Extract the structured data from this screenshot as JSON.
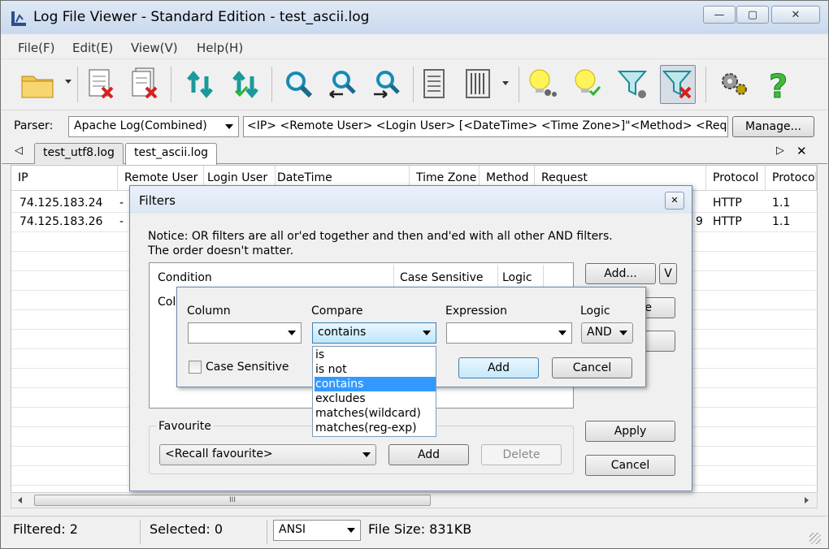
{
  "window": {
    "title": "Log File Viewer - Standard Edition - test_ascii.log",
    "controls": {
      "minimize": "—",
      "maximize": "▢",
      "close": "✕"
    }
  },
  "menu": [
    "File(F)",
    "Edit(E)",
    "View(V)",
    "Help(H)"
  ],
  "toolbar": {
    "icons": [
      "open-folder-icon",
      "close-file-icon",
      "close-all-icon",
      "refresh-icon",
      "refresh-check-icon",
      "search-icon",
      "search-prev-icon",
      "search-next-icon",
      "document-icon",
      "columns-icon",
      "bulb-settings-icon",
      "bulb-check-icon",
      "filter-settings-icon",
      "filter-remove-icon",
      "gear-icon",
      "help-icon"
    ]
  },
  "parser": {
    "label": "Parser:",
    "selected": "Apache Log(Combined)",
    "format": "<IP> <Remote User> <Login User> [<DateTime> <Time Zone>]\"<Method> <Reques",
    "manage_label": "Manage..."
  },
  "tabs": {
    "nav_left": "◁",
    "nav_right": "▷",
    "close": "✕",
    "items": [
      "test_utf8.log",
      "test_ascii.log"
    ],
    "active": 1
  },
  "table": {
    "columns": [
      "IP",
      "Remote User",
      "Login User",
      "DateTime",
      "Time Zone",
      "Method",
      "Request",
      "Protocol",
      "Protocol"
    ],
    "rows": [
      {
        "ip": "74.125.183.24",
        "remote": "-",
        "protocol": "HTTP",
        "version": "1.1",
        "extra": ""
      },
      {
        "ip": "74.125.183.26",
        "remote": "-",
        "protocol": "HTTP",
        "version": "1.1",
        "extra": "9"
      }
    ]
  },
  "scroll": {
    "thumb": "III"
  },
  "status": {
    "filtered": "Filtered: 2",
    "selected": "Selected: 0",
    "encoding": "ANSI",
    "filesize": "File Size: 831KB"
  },
  "filters_dialog": {
    "title": "Filters",
    "close": "✕",
    "notice_line1": "Notice: OR filters are all or'ed together and then and'ed with all other AND filters.",
    "notice_line2": "The order doesn't matter.",
    "list_headers": [
      "Condition",
      "Case Sensitive",
      "Logic"
    ],
    "first_cell": "Colu",
    "add_label": "Add...",
    "v_label": "V",
    "hidden_btn_text": "e",
    "favourite_label": "Favourite",
    "favourite_select": "<Recall favourite>",
    "fav_add": "Add",
    "fav_delete": "Delete",
    "apply": "Apply",
    "cancel": "Cancel"
  },
  "add_filter": {
    "column_label": "Column",
    "compare_label": "Compare",
    "expression_label": "Expression",
    "logic_label": "Logic",
    "compare_value": "contains",
    "logic_value": "AND",
    "case_sensitive": "Case Sensitive",
    "add": "Add",
    "cancel": "Cancel",
    "compare_options": [
      "is",
      "is not",
      "contains",
      "excludes",
      "matches(wildcard)",
      "matches(reg-exp)"
    ],
    "selected_option": 2
  }
}
